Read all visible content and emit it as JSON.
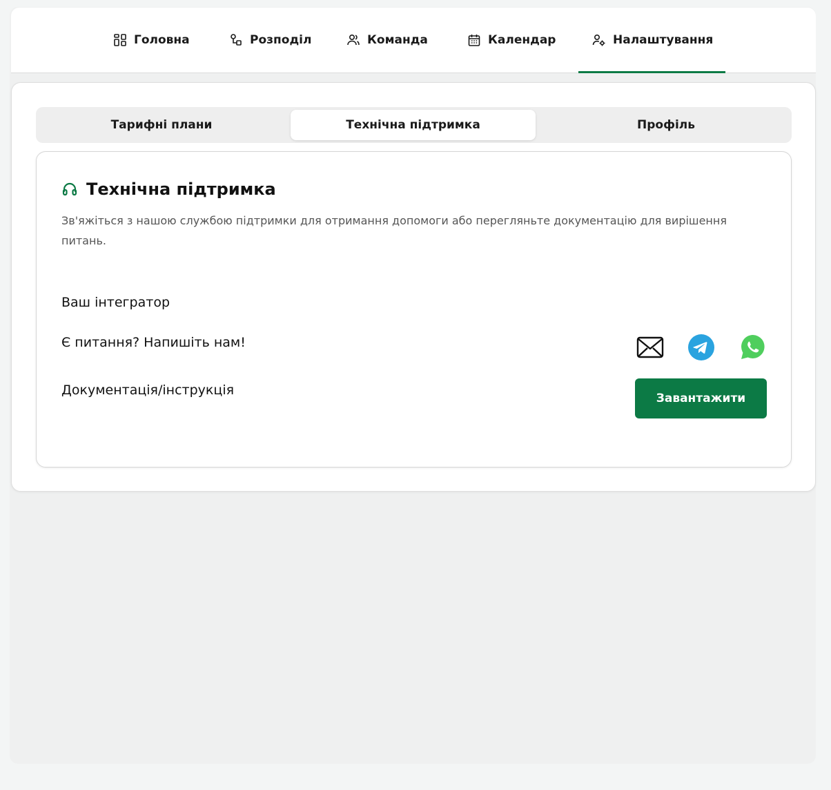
{
  "nav": {
    "items": [
      {
        "label": "Головна",
        "icon": "dashboard-icon"
      },
      {
        "label": "Розподіл",
        "icon": "distribution-icon"
      },
      {
        "label": "Команда",
        "icon": "team-icon"
      },
      {
        "label": "Календар",
        "icon": "calendar-icon"
      },
      {
        "label": "Налаштування",
        "icon": "user-settings-icon",
        "active": true
      }
    ]
  },
  "tabs": [
    {
      "label": "Тарифні плани"
    },
    {
      "label": "Технічна підтримка",
      "active": true
    },
    {
      "label": "Профіль"
    }
  ],
  "support": {
    "title": "Технічна підтримка",
    "icon": "headset-icon",
    "description": "Зв'яжіться з нашою службою підтримки для отримання допомоги або перегляньте документацію для вирішення питань.",
    "integrator_label": "Ваш інтегратор",
    "question_label": "Є питання? Напишіть нам!",
    "contacts": [
      "mail-icon",
      "telegram-icon",
      "whatsapp-icon"
    ],
    "docs_label": "Документація/інструкція",
    "download_label": "Завантажити"
  },
  "colors": {
    "accent": "#0c7a45",
    "telegram": "#2aa3df",
    "whatsapp": "#4fce5d"
  }
}
